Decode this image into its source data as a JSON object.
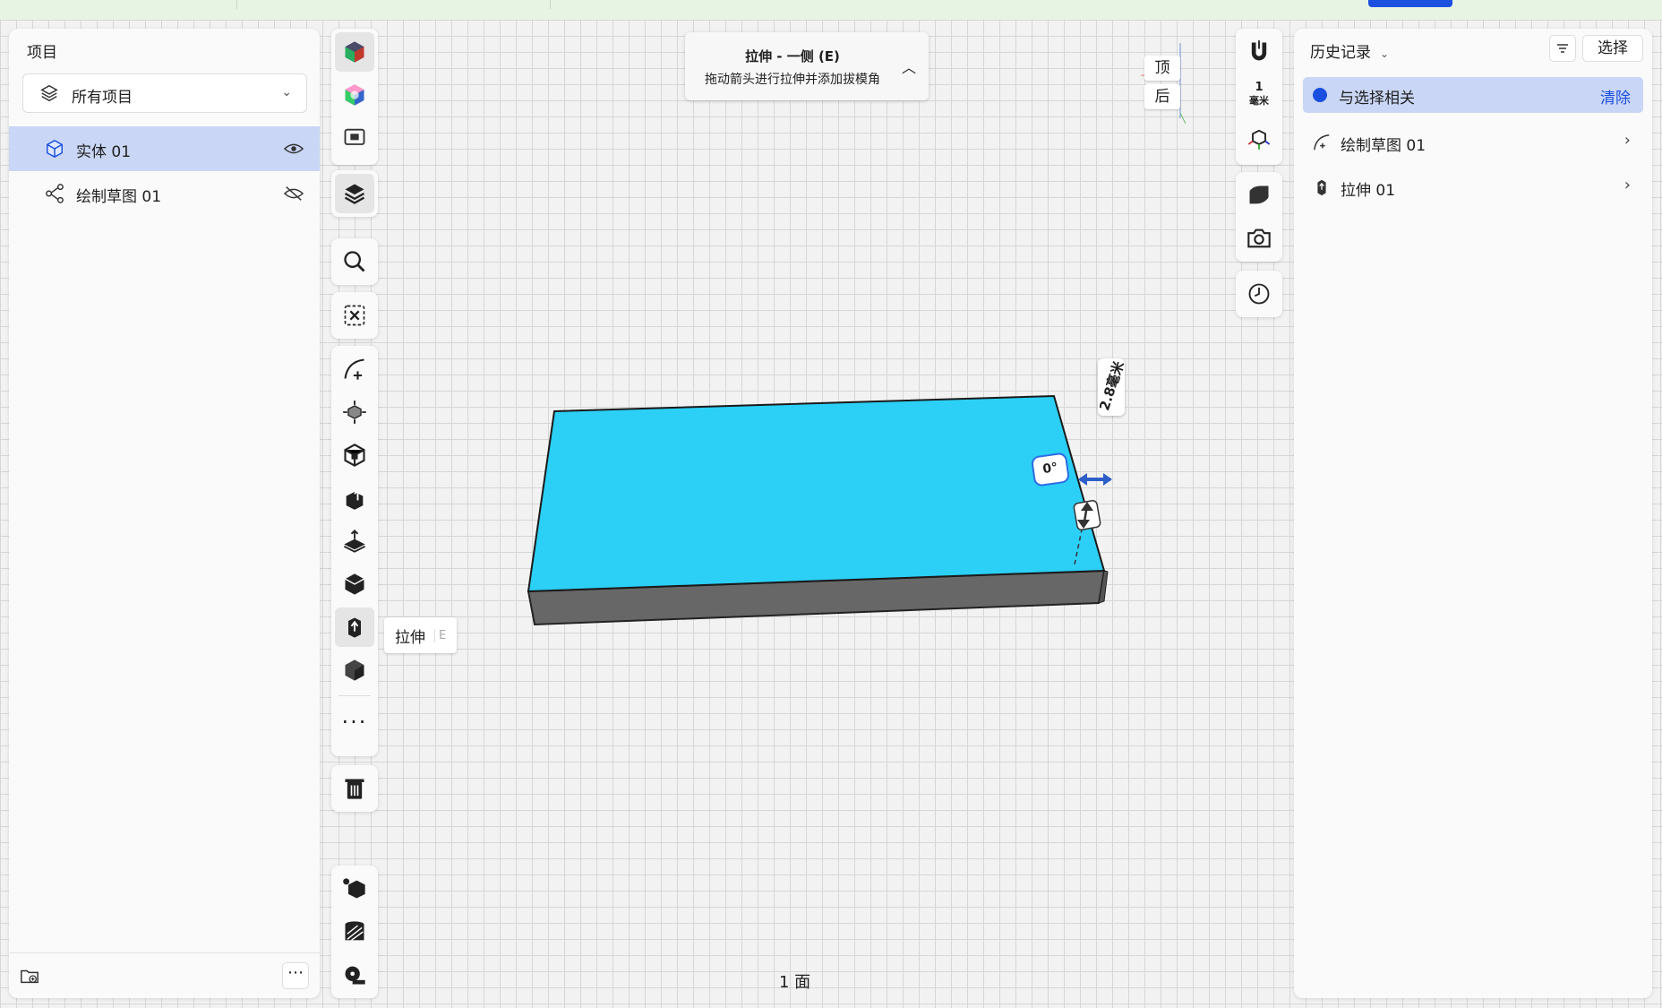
{
  "app": {
    "status_text": "1 面",
    "accent_color": "#1a4fe0",
    "solid_color": "#2ccff5"
  },
  "left_panel": {
    "title": "项目",
    "project_selector": {
      "label": "所有项目",
      "icon": "layers-icon"
    },
    "tree": [
      {
        "label": "实体 01",
        "icon": "cube-icon",
        "visibility": "eye-icon",
        "selected": true
      },
      {
        "label": "绘制草图 01",
        "icon": "sketch-nodes-icon",
        "visibility": "eye-off-icon",
        "selected": false
      }
    ],
    "footer": {
      "add_icon": "new-folder-icon",
      "more_label": "⋯"
    }
  },
  "toolbar": {
    "tooltip": {
      "label": "拉伸",
      "key": "E"
    }
  },
  "hint": {
    "title": "拉伸 - 一侧 (E)",
    "subtitle": "拖动箭头进行拉伸并添加拔模角"
  },
  "viewport": {
    "dimension_label": "2.8毫米",
    "angle_label": "0°",
    "view_cube": {
      "top": "顶",
      "back": "后"
    }
  },
  "right_toolbar": {
    "scale_value": "1",
    "scale_unit": "毫米"
  },
  "right_panel": {
    "title": "历史记录",
    "select_button": "选择",
    "related_label": "与选择相关",
    "clear_label": "清除",
    "items": [
      {
        "label": "绘制草图 01",
        "icon": "sketch-icon"
      },
      {
        "label": "拉伸 01",
        "icon": "extrude-icon"
      }
    ]
  }
}
